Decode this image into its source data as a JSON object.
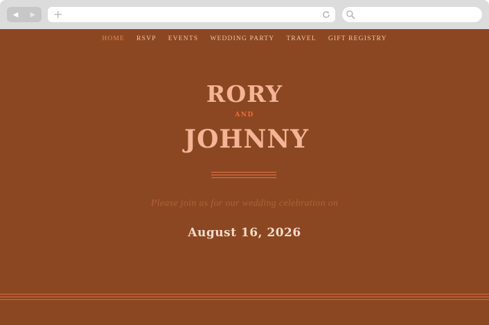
{
  "browser": {
    "back_icon": "◀",
    "forward_icon": "▶",
    "new_tab_icon": "+",
    "address_placeholder": "",
    "search_placeholder": ""
  },
  "nav": {
    "items": [
      {
        "label": "HOME",
        "active": true
      },
      {
        "label": "RSVP",
        "active": false
      },
      {
        "label": "EVENTS",
        "active": false
      },
      {
        "label": "WEDDING PARTY",
        "active": false
      },
      {
        "label": "TRAVEL",
        "active": false
      },
      {
        "label": "GIFT REGISTRY",
        "active": false
      }
    ]
  },
  "hero": {
    "name_one": "RORY",
    "conjunction": "AND",
    "name_two": "JOHNNY",
    "invite_line": "Please join us for our wedding celebration on",
    "date": "August 16, 2026"
  },
  "colors": {
    "background": "#8b4722",
    "name": "#f3b596",
    "accent": "#ef6d33",
    "nav_text": "#f2c6a8",
    "nav_active": "#e88a57",
    "date": "#f6dccb",
    "chrome": "#dcdcdc"
  },
  "icons": {
    "reload": "reload-icon",
    "search": "search-icon",
    "plus": "plus-icon"
  }
}
